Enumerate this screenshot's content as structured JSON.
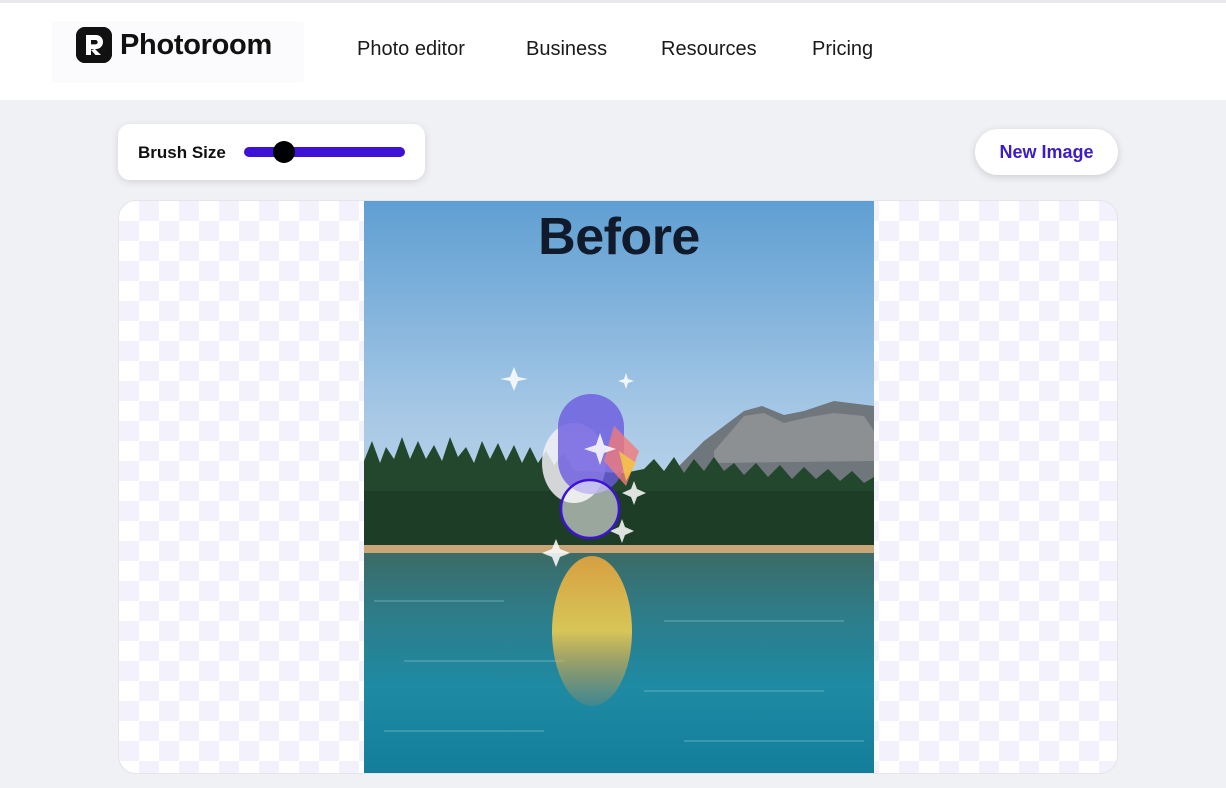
{
  "header": {
    "logo_text": "Photoroom",
    "nav": [
      {
        "label": "Photo editor"
      },
      {
        "label": "Business"
      },
      {
        "label": "Resources"
      },
      {
        "label": "Pricing"
      }
    ]
  },
  "toolbar": {
    "brush_label": "Brush Size",
    "brush_value": 0.25,
    "accent_color": "#3e12d6"
  },
  "actions": {
    "new_image_label": "New Image"
  },
  "canvas": {
    "overlay_text": "Before"
  }
}
